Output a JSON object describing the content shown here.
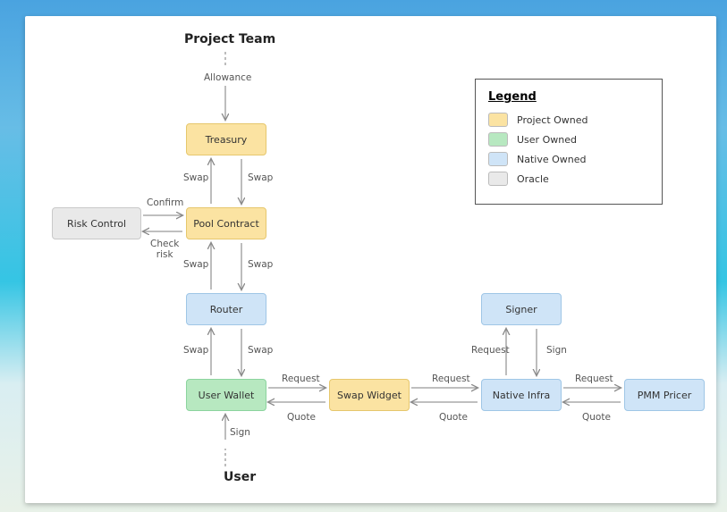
{
  "titles": {
    "top": "Project Team",
    "bottom": "User"
  },
  "edges": {
    "allowance": "Allowance",
    "swap": "Swap",
    "confirm": "Confirm",
    "check_risk": "Check\nrisk",
    "request": "Request",
    "quote": "Quote",
    "sign": "Sign"
  },
  "nodes": {
    "treasury": "Treasury",
    "pool_contract": "Pool Contract",
    "risk_control": "Risk Control",
    "router": "Router",
    "user_wallet": "User Wallet",
    "swap_widget": "Swap Widget",
    "native_infra": "Native Infra",
    "signer": "Signer",
    "pmm_pricer": "PMM Pricer"
  },
  "legend": {
    "title": "Legend",
    "items": [
      {
        "label": "Project Owned",
        "class": "yellow"
      },
      {
        "label": "User Owned",
        "class": "green"
      },
      {
        "label": "Native Owned",
        "class": "blue"
      },
      {
        "label": "Oracle",
        "class": "grey"
      }
    ]
  },
  "colors": {
    "yellow": "#fbe3a2",
    "green": "#b7e8c0",
    "blue": "#cfe4f7",
    "grey": "#e9e9e9"
  }
}
